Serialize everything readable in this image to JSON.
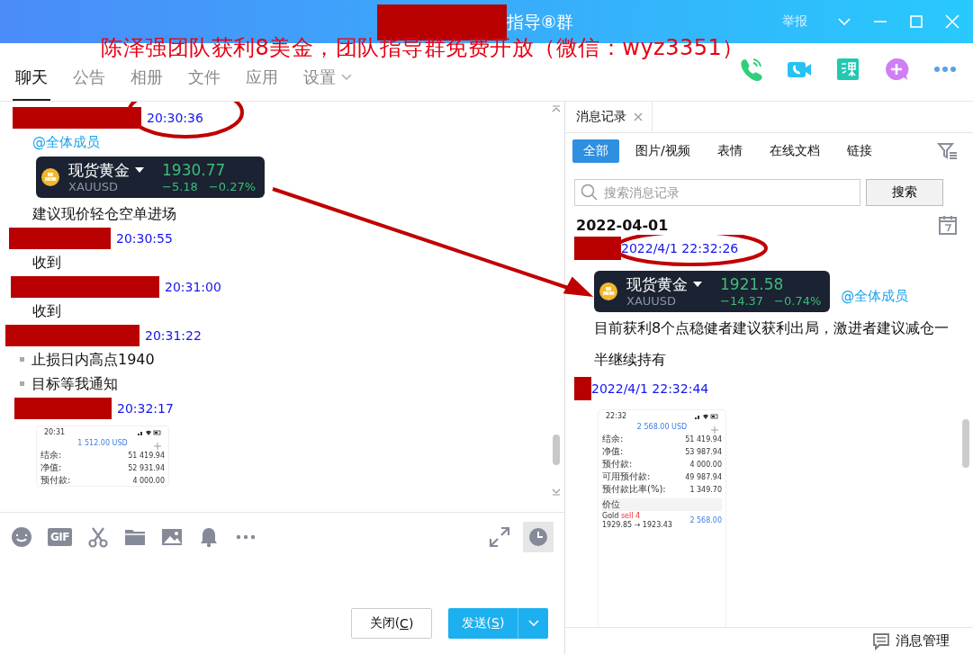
{
  "window": {
    "title": "指导⑧群",
    "report": "举报"
  },
  "overlay_text": "陈泽强团队获利8美金，团队指导群免费开放（微信：wyz3351）",
  "tabs": [
    {
      "label": "聊天",
      "selected": true,
      "kind": "tab"
    },
    {
      "label": "公告",
      "selected": false,
      "kind": "tab"
    },
    {
      "label": "相册",
      "selected": false,
      "kind": "tab"
    },
    {
      "label": "文件",
      "selected": false,
      "kind": "tab"
    },
    {
      "label": "应用",
      "selected": false,
      "kind": "tab"
    },
    {
      "label": "设置",
      "selected": false,
      "kind": "menu"
    }
  ],
  "chat": {
    "messages": [
      {
        "time": "20:30:36",
        "circled": true,
        "body": [
          {
            "kind": "mention",
            "text": "@全体成员"
          },
          {
            "kind": "quote",
            "name": "现货黄金",
            "symbol": "XAUUSD",
            "price": "1930.77",
            "change": "−5.18",
            "percent": "−0.27%"
          },
          {
            "kind": "text",
            "text": "建议现价轻仓空单进场"
          }
        ]
      },
      {
        "time": "20:30:55",
        "circled": false,
        "body": [
          {
            "kind": "text",
            "text": "收到"
          }
        ]
      },
      {
        "time": "20:31:00",
        "circled": false,
        "body": [
          {
            "kind": "text",
            "text": "收到"
          }
        ]
      },
      {
        "time": "20:31:22",
        "circled": false,
        "body": [
          {
            "kind": "bullet",
            "text": "止损日内高点1940"
          },
          {
            "kind": "bullet",
            "text": "目标等我通知"
          }
        ]
      },
      {
        "time": "20:32:17",
        "circled": false,
        "body": [
          {
            "kind": "screenshot",
            "clock": "20:31",
            "balance": "1 512.00 USD",
            "rows": [
              {
                "label": "结余:",
                "value": "51 419.94"
              },
              {
                "label": "净值:",
                "value": "52 931.94"
              },
              {
                "label": "预付款:",
                "value": "4 000.00"
              }
            ]
          }
        ]
      }
    ]
  },
  "toolbar": [
    {
      "kind": "emoji"
    },
    {
      "kind": "gif",
      "text": "GIF"
    },
    {
      "kind": "scissors"
    },
    {
      "kind": "folder"
    },
    {
      "kind": "image"
    },
    {
      "kind": "bell"
    },
    {
      "kind": "more"
    }
  ],
  "buttons": {
    "close": [
      "关闭(",
      "C",
      ")"
    ],
    "send": [
      "发送(",
      "S",
      ")"
    ]
  },
  "history": {
    "tab": "消息记录",
    "filters": [
      {
        "label": "全部",
        "selected": true
      },
      {
        "label": "图片/视频",
        "selected": false
      },
      {
        "label": "表情",
        "selected": false
      },
      {
        "label": "在线文档",
        "selected": false
      },
      {
        "label": "链接",
        "selected": false
      }
    ],
    "search": {
      "placeholder": "搜索消息记录",
      "button": "搜索"
    },
    "date": "2022-04-01",
    "messages": [
      {
        "time": "2022/4/1 22:32:26",
        "circled": true,
        "body": [
          {
            "kind": "quote",
            "name": "现货黄金",
            "symbol": "XAUUSD",
            "price": "1921.58",
            "change": "−14.37",
            "percent": "−0.74%"
          },
          {
            "kind": "mention",
            "text": "@全体成员"
          },
          {
            "kind": "text",
            "text": "目前获利8个点稳健者建议获利出局，激进者建议减仓一半继续持有"
          }
        ]
      },
      {
        "time": "2022/4/1 22:32:44",
        "circled": false,
        "body": [
          {
            "kind": "screenshot",
            "clock": "22:32",
            "balance": "2 568.00 USD",
            "rows": [
              {
                "label": "结余:",
                "value": "51 419.94"
              },
              {
                "label": "净值:",
                "value": "53 987.94"
              },
              {
                "label": "预付款:",
                "value": "4 000.00"
              },
              {
                "label": "可用预付款:",
                "value": "49 987.94"
              },
              {
                "label": "预付款比率(%):",
                "value": "1 349.70"
              }
            ],
            "section": "价位",
            "position": {
              "symbol": "Gold",
              "side": "sell 4",
              "prices": "1929.85 → 1923.43",
              "profit": "2 568.00"
            }
          }
        ]
      }
    ]
  },
  "manage": "消息管理"
}
